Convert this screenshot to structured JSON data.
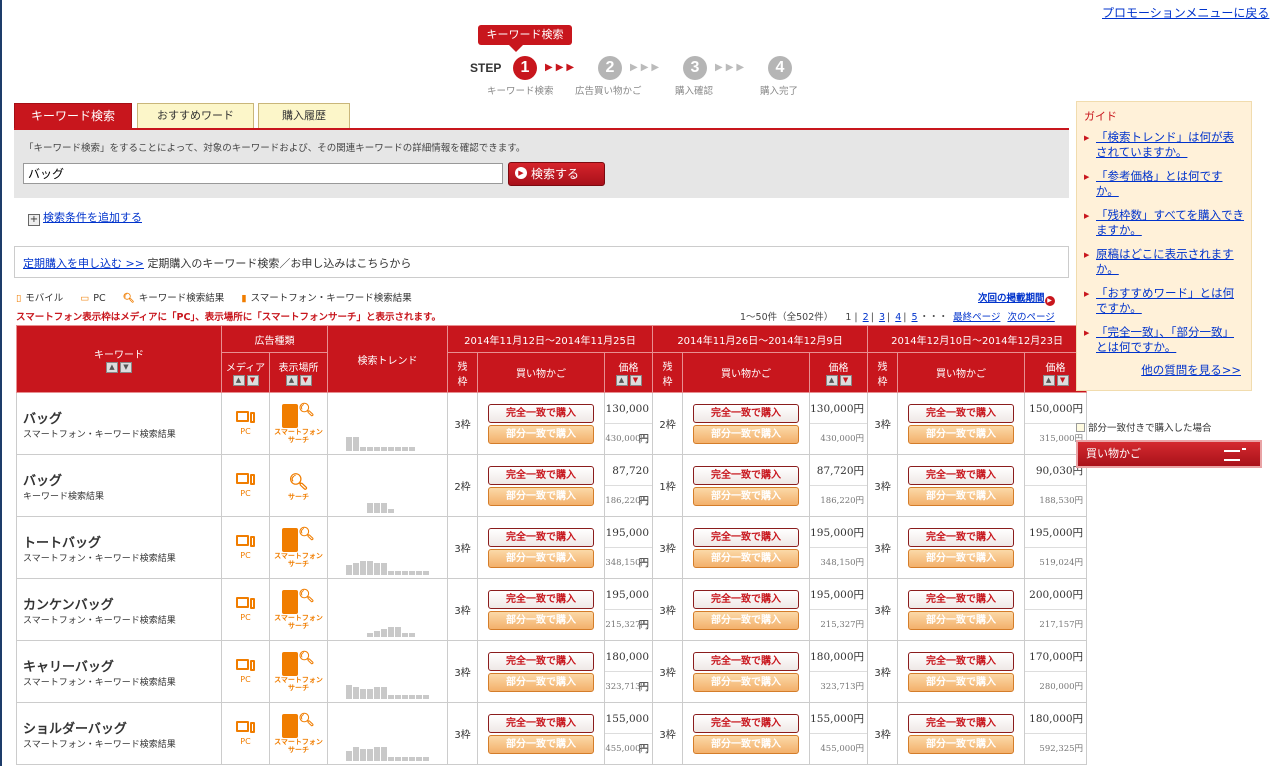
{
  "top_link": "プロモーションメニューに戻る",
  "steps": {
    "callout": "キーワード検索",
    "label": "STEP",
    "items": [
      {
        "num": "1",
        "name": "キーワード検索",
        "active": true
      },
      {
        "num": "2",
        "name": "広告買い物かご",
        "active": false
      },
      {
        "num": "3",
        "name": "購入確認",
        "active": false
      },
      {
        "num": "4",
        "name": "購入完了",
        "active": false
      }
    ],
    "arrows": "▶▶▶"
  },
  "tabs": [
    "キーワード検索",
    "おすすめワード",
    "購入履歴"
  ],
  "search": {
    "description": "「キーワード検索」をすることによって、対象のキーワードおよび、その関連キーワードの詳細情報を確認できます。",
    "value": "バッグ",
    "button": "検索する"
  },
  "add_condition": {
    "plus": "+",
    "label": "検索条件を追加する"
  },
  "regular": {
    "link": "定期購入を申し込む >>",
    "text": "定期購入のキーワード検索／お申し込みはこちらから"
  },
  "legend": [
    {
      "icon": "▯",
      "label": "モバイル"
    },
    {
      "icon": "▭",
      "label": "PC"
    },
    {
      "icon": "🔍︎",
      "label": "キーワード検索結果"
    },
    {
      "icon": "▮",
      "label": "スマートフォン・キーワード検索結果"
    }
  ],
  "notice": "スマートフォン表示枠はメディアに「PC」、表示場所に「スマートフォンサーチ」と表示されます。",
  "next_period": {
    "label": "次回の掲載期間",
    "icon": "▶"
  },
  "pager": {
    "range": "1～50件（全502件）",
    "pages": [
      "1",
      "2",
      "3",
      "4",
      "5"
    ],
    "ellipsis": "・・・",
    "last": "最終ページ",
    "next": "次のページ"
  },
  "table": {
    "h_keyword": "キーワード",
    "h_adtype": "広告種類",
    "h_media": "メディア",
    "h_place": "表示場所",
    "h_trend": "検索トレンド",
    "h_slots": "残枠",
    "h_cart": "買い物かご",
    "h_price": "価格",
    "sort_up": "▲",
    "sort_down": "▼",
    "btn_full": "完全一致で購入",
    "btn_part": "部分一致で購入",
    "periods": [
      "2014年11月12日～2014年11月25日",
      "2014年11月26日～2014年12月9日",
      "2014年12月10日～2014年12月23日"
    ],
    "media_pc": "PC",
    "place_sp": "スマートフォン\nサーチ",
    "place_search": "サーチ",
    "rows": [
      {
        "kw": "バッグ",
        "sub": "スマートフォン・キーワード検索結果",
        "place": "sp",
        "trend": [
          14,
          14,
          4,
          4,
          4,
          4,
          4,
          4,
          4,
          4
        ],
        "cells": [
          {
            "slots": "3枠",
            "full": "130,000円",
            "part": "430,000円"
          },
          {
            "slots": "2枠",
            "full": "130,000円",
            "part": "430,000円"
          },
          {
            "slots": "3枠",
            "full": "150,000円",
            "part": "315,000円"
          }
        ]
      },
      {
        "kw": "バッグ",
        "sub": "キーワード検索結果",
        "place": "search",
        "trend": [
          0,
          0,
          0,
          10,
          10,
          10,
          4,
          0,
          0,
          0
        ],
        "cells": [
          {
            "slots": "2枠",
            "full": "87,720円",
            "part": "186,220円"
          },
          {
            "slots": "1枠",
            "full": "87,720円",
            "part": "186,220円"
          },
          {
            "slots": "3枠",
            "full": "90,030円",
            "part": "188,530円"
          }
        ]
      },
      {
        "kw": "トートバッグ",
        "sub": "スマートフォン・キーワード検索結果",
        "place": "sp",
        "trend": [
          10,
          12,
          14,
          14,
          12,
          12,
          4,
          4,
          4,
          4,
          4,
          4
        ],
        "cells": [
          {
            "slots": "3枠",
            "full": "195,000円",
            "part": "348,150円"
          },
          {
            "slots": "3枠",
            "full": "195,000円",
            "part": "348,150円"
          },
          {
            "slots": "3枠",
            "full": "195,000円",
            "part": "519,024円"
          }
        ]
      },
      {
        "kw": "カンケンバッグ",
        "sub": "スマートフォン・キーワード検索結果",
        "place": "sp",
        "trend": [
          0,
          0,
          0,
          4,
          6,
          8,
          10,
          10,
          4,
          4
        ],
        "cells": [
          {
            "slots": "3枠",
            "full": "195,000円",
            "part": "215,327円"
          },
          {
            "slots": "3枠",
            "full": "195,000円",
            "part": "215,327円"
          },
          {
            "slots": "3枠",
            "full": "200,000円",
            "part": "217,157円"
          }
        ]
      },
      {
        "kw": "キャリーバッグ",
        "sub": "スマートフォン・キーワード検索結果",
        "place": "sp",
        "trend": [
          14,
          12,
          10,
          10,
          12,
          12,
          4,
          4,
          4,
          4,
          4,
          4
        ],
        "cells": [
          {
            "slots": "3枠",
            "full": "180,000円",
            "part": "323,713円"
          },
          {
            "slots": "3枠",
            "full": "180,000円",
            "part": "323,713円"
          },
          {
            "slots": "3枠",
            "full": "170,000円",
            "part": "280,000円"
          }
        ]
      },
      {
        "kw": "ショルダーバッグ",
        "sub": "スマートフォン・キーワード検索結果",
        "place": "sp",
        "trend": [
          10,
          14,
          12,
          12,
          14,
          14,
          4,
          4,
          4,
          4,
          4,
          4
        ],
        "cells": [
          {
            "slots": "3枠",
            "full": "155,000円",
            "part": "455,000円"
          },
          {
            "slots": "3枠",
            "full": "155,000円",
            "part": "455,000円"
          },
          {
            "slots": "3枠",
            "full": "180,000円",
            "part": "592,325円"
          }
        ]
      }
    ]
  },
  "guide": {
    "title": "ガイド",
    "items": [
      "「検索トレンド」は何が表されていますか。",
      "「参考価格」とは何ですか。",
      "「残枠数」すべてを購入できますか。",
      "原稿はどこに表示されますか。",
      "「おすすめワード」とは何ですか。",
      "「完全一致」、「部分一致」とは何ですか。"
    ],
    "more": "他の質問を見る>>"
  },
  "partial_note": "部分一致付きで購入した場合",
  "cart": "買い物かご",
  "colors": {
    "accent": "#c8161d",
    "orange": "#f07d00",
    "guide_bg": "#fff1d9"
  }
}
